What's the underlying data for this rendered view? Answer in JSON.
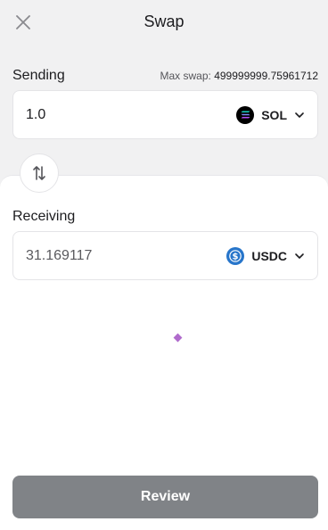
{
  "header": {
    "title": "Swap",
    "close_icon": "close-icon"
  },
  "sending": {
    "label": "Sending",
    "max_swap_label": "Max swap:",
    "max_swap_value": "499999999.75961712",
    "amount": "1.0",
    "token": "SOL",
    "token_icon": "solana-logo-icon"
  },
  "swap_direction_icon": "swap-vertical-arrows-icon",
  "receiving": {
    "label": "Receiving",
    "amount": "31.169117",
    "token": "USDC",
    "token_icon": "usdc-logo-icon"
  },
  "review_button": "Review",
  "colors": {
    "background": "#f1f1f2",
    "panel": "#ffffff",
    "review_button": "#808387",
    "loader": "#b06bcc",
    "usdc_blue": "#2775ca"
  }
}
